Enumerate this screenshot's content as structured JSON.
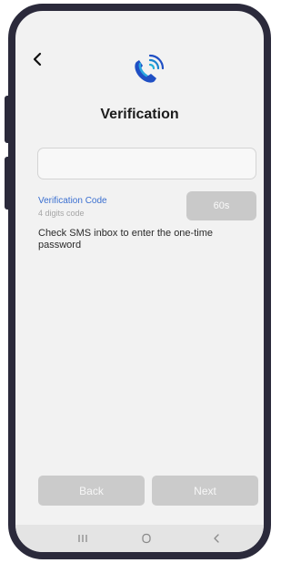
{
  "screen": {
    "title": "Verification",
    "code_input": {
      "value": "",
      "placeholder": ""
    },
    "field_label": "Verification Code",
    "field_hint": "4 digits code",
    "timer_label": "60s",
    "instructions": "Check SMS inbox to enter the one-time password"
  },
  "actions": {
    "back_label": "Back",
    "next_label": "Next"
  },
  "colors": {
    "frame": "#2b2a3b",
    "accent_blue": "#3a6fd0",
    "disabled_button": "#cbcbcb",
    "screen_bg": "#f2f2f2"
  },
  "icons": {
    "top_back": "chevron-left-icon",
    "logo": "phone-signal-logo-icon",
    "nav_recent": "recent-apps-icon",
    "nav_home": "home-icon",
    "nav_back": "nav-back-icon"
  }
}
